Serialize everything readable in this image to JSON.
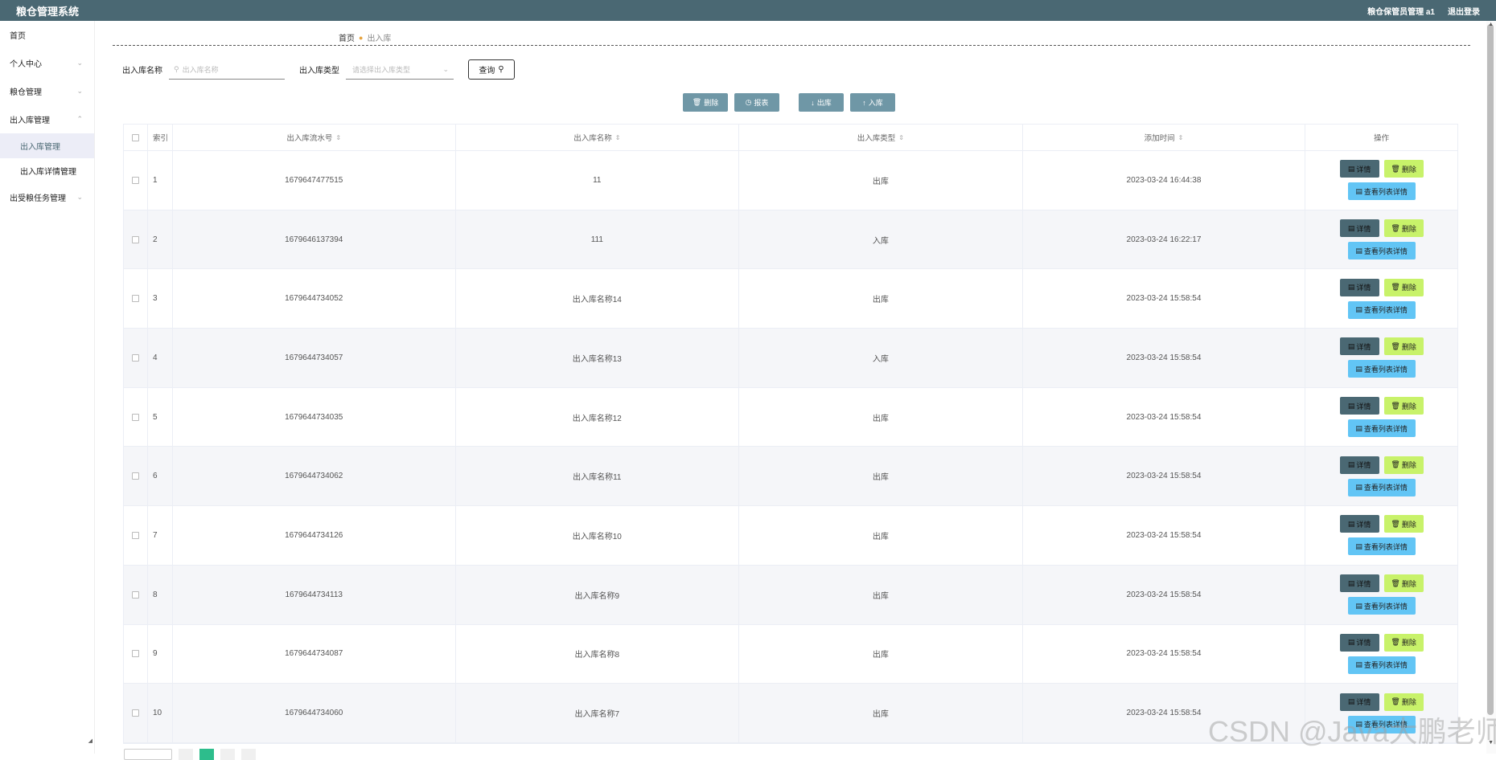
{
  "app": {
    "title": "粮仓管理系统",
    "user_label": "粮仓保管员管理 a1",
    "logout": "退出登录"
  },
  "sidebar": {
    "items": [
      {
        "label": "首页",
        "has_children": false
      },
      {
        "label": "个人中心",
        "has_children": true
      },
      {
        "label": "粮仓管理",
        "has_children": true
      },
      {
        "label": "出入库管理",
        "has_children": true,
        "expanded": true
      },
      {
        "label": "出入库管理",
        "child": true,
        "active": true
      },
      {
        "label": "出入库详情管理",
        "child": true
      },
      {
        "label": "出受粮任务管理",
        "has_children": true
      }
    ]
  },
  "breadcrumb": {
    "home": "首页",
    "current": "出入库"
  },
  "filter": {
    "name_label": "出入库名称",
    "name_placeholder": "出入库名称",
    "type_label": "出入库类型",
    "type_placeholder": "请选择出入库类型",
    "query_button": "查询"
  },
  "toolbar": {
    "delete": "删除",
    "report": "报表",
    "out": "出库",
    "in": "入库"
  },
  "table": {
    "columns": [
      "索引",
      "出入库流水号",
      "出入库名称",
      "出入库类型",
      "添加时间",
      "操作"
    ],
    "rows": [
      {
        "idx": "1",
        "serial": "1679647477515",
        "name": "11",
        "type": "出库",
        "time": "2023-03-24 16:44:38"
      },
      {
        "idx": "2",
        "serial": "1679646137394",
        "name": "111",
        "type": "入库",
        "time": "2023-03-24 16:22:17"
      },
      {
        "idx": "3",
        "serial": "1679644734052",
        "name": "出入库名称14",
        "type": "出库",
        "time": "2023-03-24 15:58:54"
      },
      {
        "idx": "4",
        "serial": "1679644734057",
        "name": "出入库名称13",
        "type": "入库",
        "time": "2023-03-24 15:58:54"
      },
      {
        "idx": "5",
        "serial": "1679644734035",
        "name": "出入库名称12",
        "type": "出库",
        "time": "2023-03-24 15:58:54"
      },
      {
        "idx": "6",
        "serial": "1679644734062",
        "name": "出入库名称11",
        "type": "出库",
        "time": "2023-03-24 15:58:54"
      },
      {
        "idx": "7",
        "serial": "1679644734126",
        "name": "出入库名称10",
        "type": "出库",
        "time": "2023-03-24 15:58:54"
      },
      {
        "idx": "8",
        "serial": "1679644734113",
        "name": "出入库名称9",
        "type": "出库",
        "time": "2023-03-24 15:58:54"
      },
      {
        "idx": "9",
        "serial": "1679644734087",
        "name": "出入库名称8",
        "type": "出库",
        "time": "2023-03-24 15:58:54"
      },
      {
        "idx": "10",
        "serial": "1679644734060",
        "name": "出入库名称7",
        "type": "出库",
        "time": "2023-03-24 15:58:54"
      }
    ],
    "op_detail": "详情",
    "op_delete": "删除",
    "op_view": "查看列表详情"
  },
  "watermark": "CSDN @Java大鹏老师",
  "colors": {
    "header_bg": "#4a6873",
    "toolbar_btn": "#6f97a6",
    "delete_btn": "#c8f26a",
    "view_btn": "#62c5f5",
    "pager_active": "#2dbd8c"
  }
}
